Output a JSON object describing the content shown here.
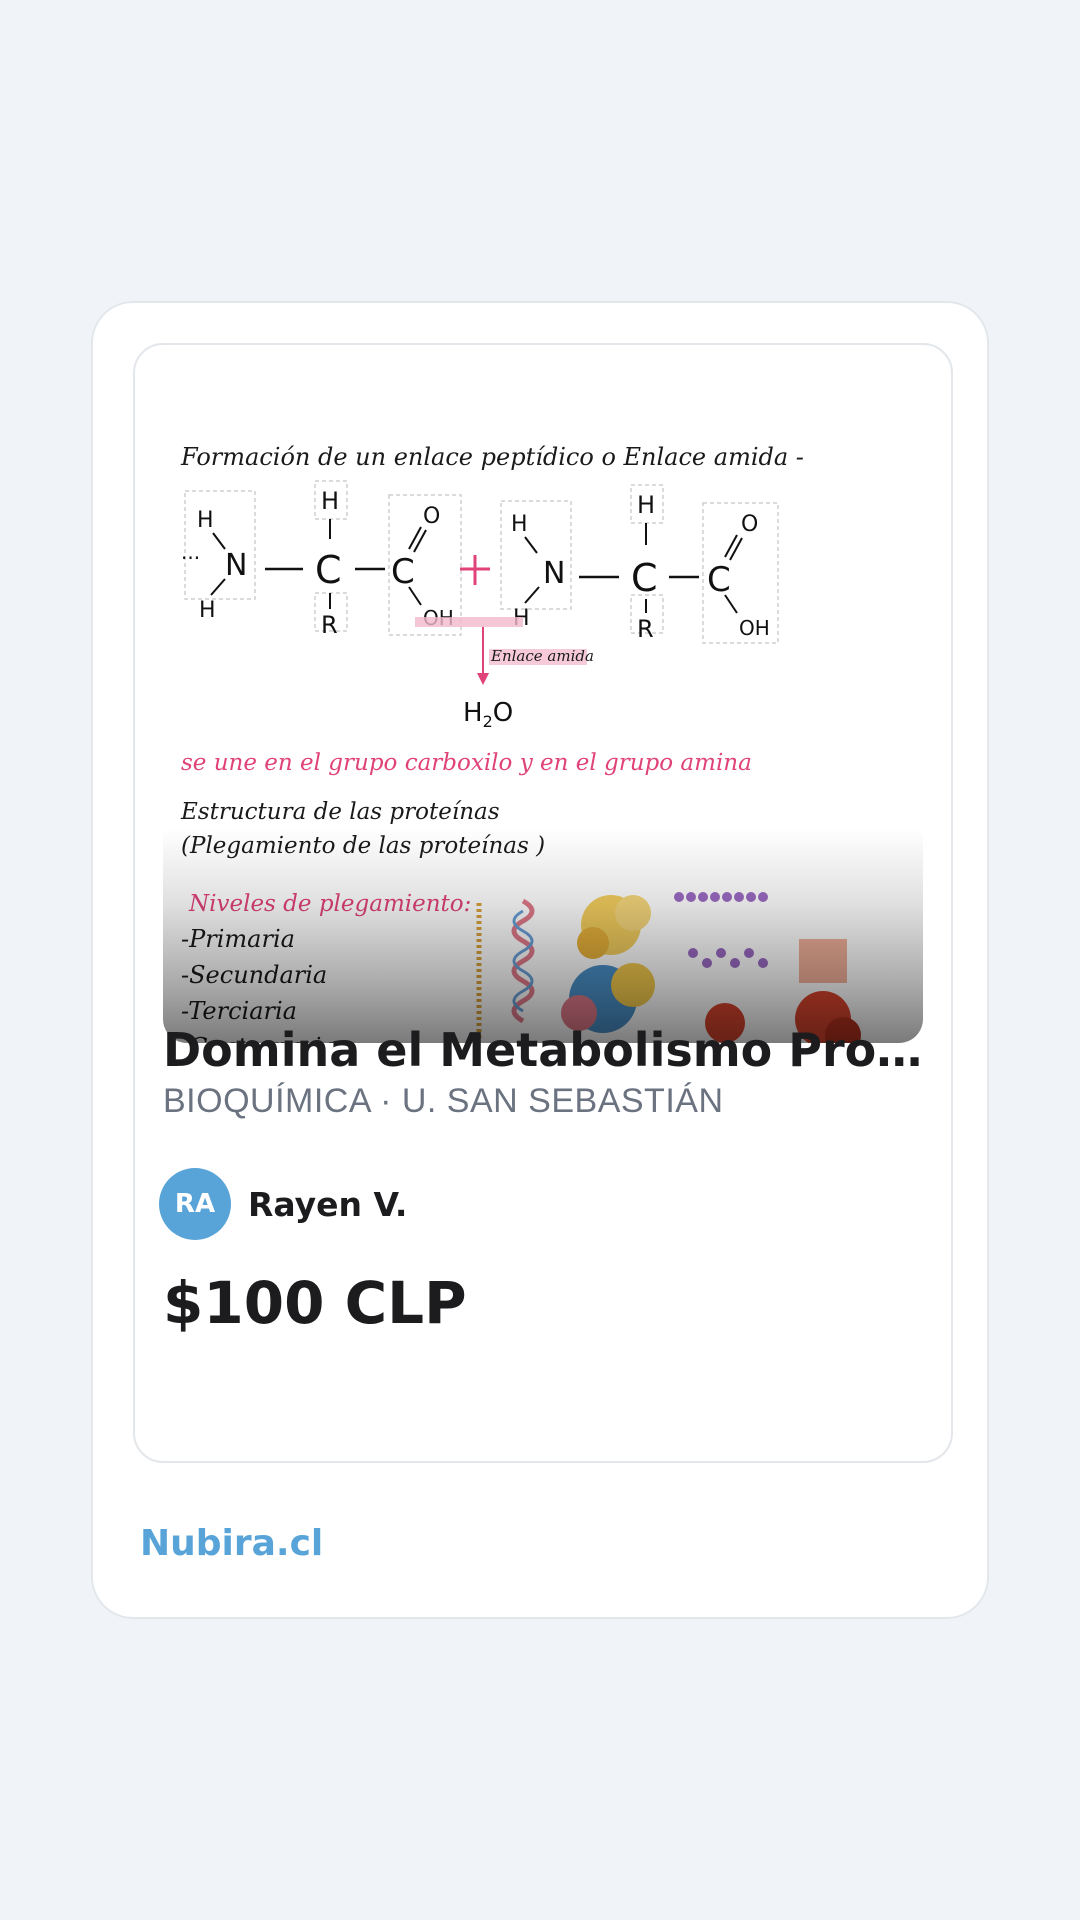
{
  "listing": {
    "title": "Domina el Metabolismo Prot...",
    "subtitle": "BIOQUÍMICA · U. SAN SEBASTIÁN",
    "author_initials": "RA",
    "author_name": "Rayen V.",
    "price": "$100 CLP"
  },
  "thumbnail": {
    "heading": "Formación de un enlace peptídico o Enlace amida -",
    "amide_label": "Enlace amida",
    "join_note": "se une en el grupo carboxilo y en el grupo amina",
    "structure_line1": "Estructura de las proteínas",
    "structure_line2": "(Plegamiento de las proteínas )",
    "levels_heading": "Niveles de plegamiento:",
    "level1": "-Primaria",
    "level2": "-Secundaria",
    "level3": "-Terciaria",
    "level4": "-Cuaternaria"
  },
  "footer": {
    "brand": "Nubira.cl"
  },
  "colors": {
    "page_bg": "#f0f4f8",
    "accent": "#58a4d8",
    "note_pink": "#e0427a",
    "text_dark": "#1c1c1e",
    "text_muted": "#6b7280"
  }
}
